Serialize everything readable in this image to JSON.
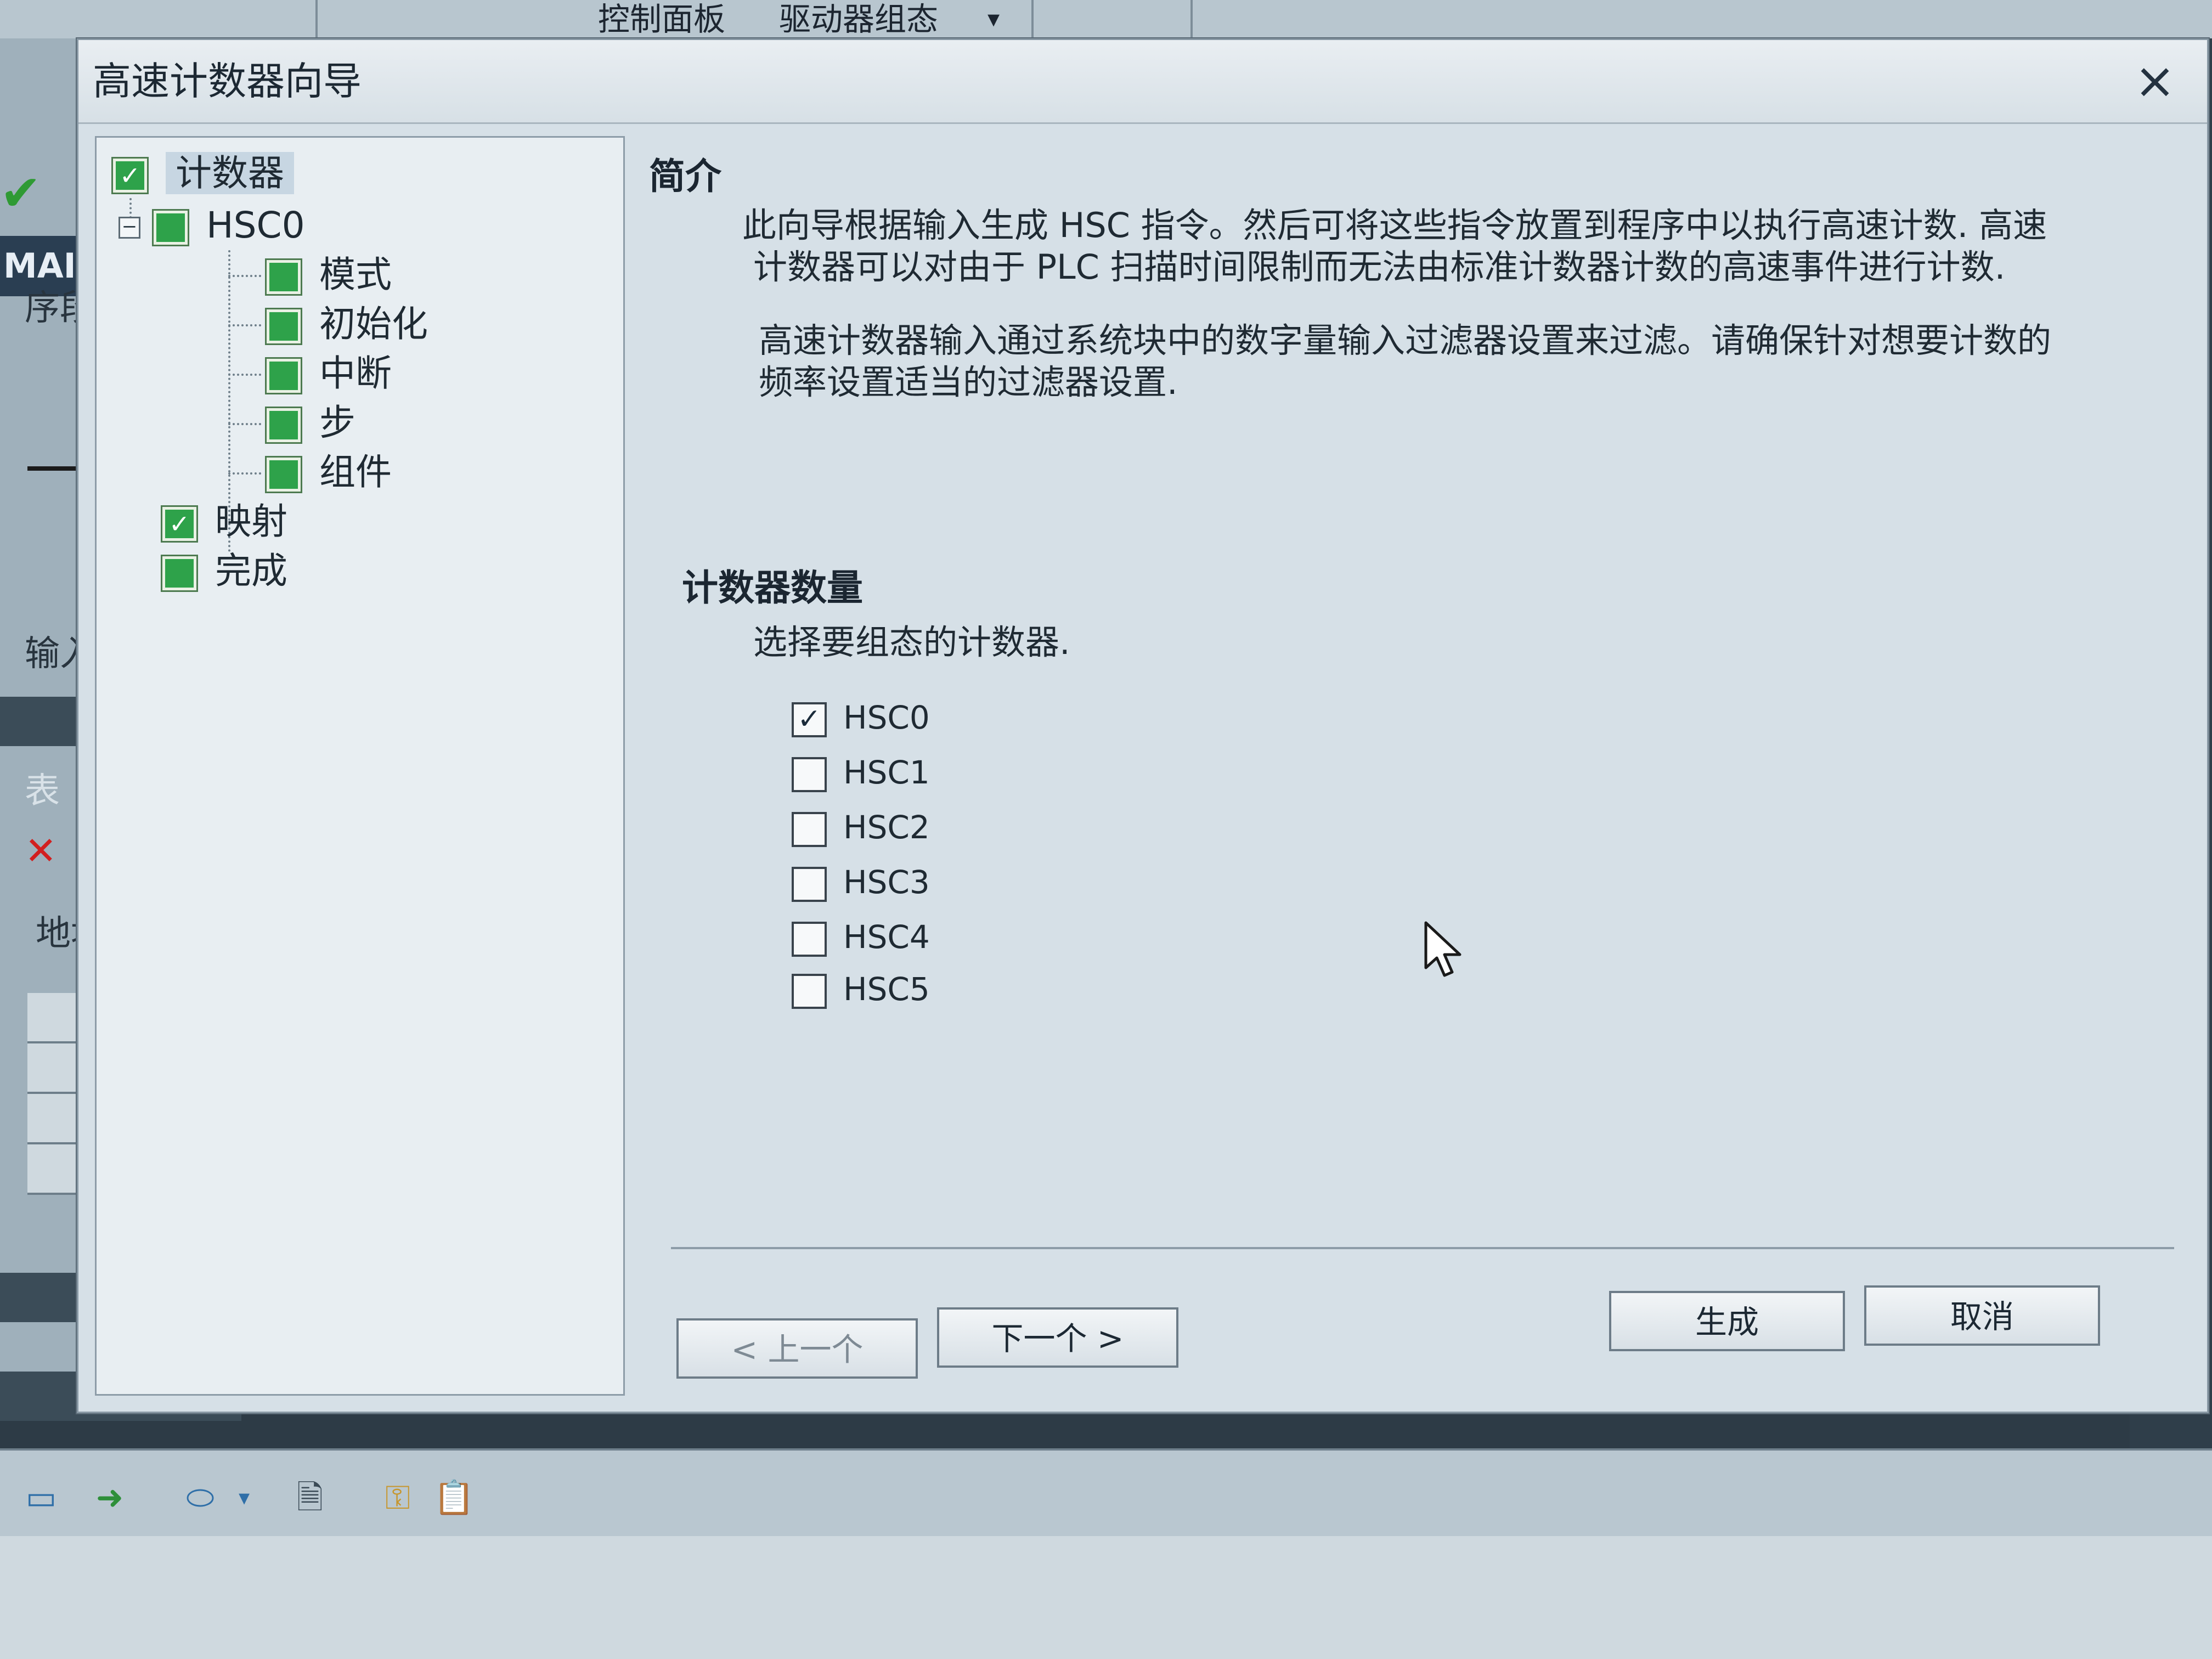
{
  "background": {
    "menu": {
      "control_panel": "控制面板",
      "drive_config": "驱动器组态"
    },
    "left_panel": {
      "tab_main": "MAIN",
      "segment_text": "序段注",
      "input_comment": "输入注释",
      "address": "地址",
      "table_label": "表"
    }
  },
  "dialog": {
    "title": "高速计数器向导",
    "close": "×",
    "tree": {
      "root": "计数器",
      "hsc0": "HSC0",
      "mode": "模式",
      "init": "初始化",
      "interrupt": "中断",
      "step": "步",
      "component": "组件",
      "mapping": "映射",
      "complete": "完成"
    },
    "intro": {
      "title": "简介",
      "para1_line1": "此向导根据输入生成 HSC 指令。然后可将这些指令放置到程序中以执行高速计数. 高速",
      "para1_line2": "计数器可以对由于 PLC 扫描时间限制而无法由标准计数器计数的高速事件进行计数.",
      "para2_line1": "高速计数器输入通过系统块中的数字量输入过滤器设置来过滤。请确保针对想要计数的",
      "para2_line2": "频率设置适当的过滤器设置."
    },
    "counters": {
      "title": "计数器数量",
      "instruction": "选择要组态的计数器.",
      "items": [
        {
          "label": "HSC0",
          "checked": true
        },
        {
          "label": "HSC1",
          "checked": false
        },
        {
          "label": "HSC2",
          "checked": false
        },
        {
          "label": "HSC3",
          "checked": false
        },
        {
          "label": "HSC4",
          "checked": false
        },
        {
          "label": "HSC5",
          "checked": false
        }
      ]
    },
    "buttons": {
      "prev": "< 上一个",
      "next": "下一个 >",
      "generate": "生成",
      "cancel": "取消"
    }
  }
}
